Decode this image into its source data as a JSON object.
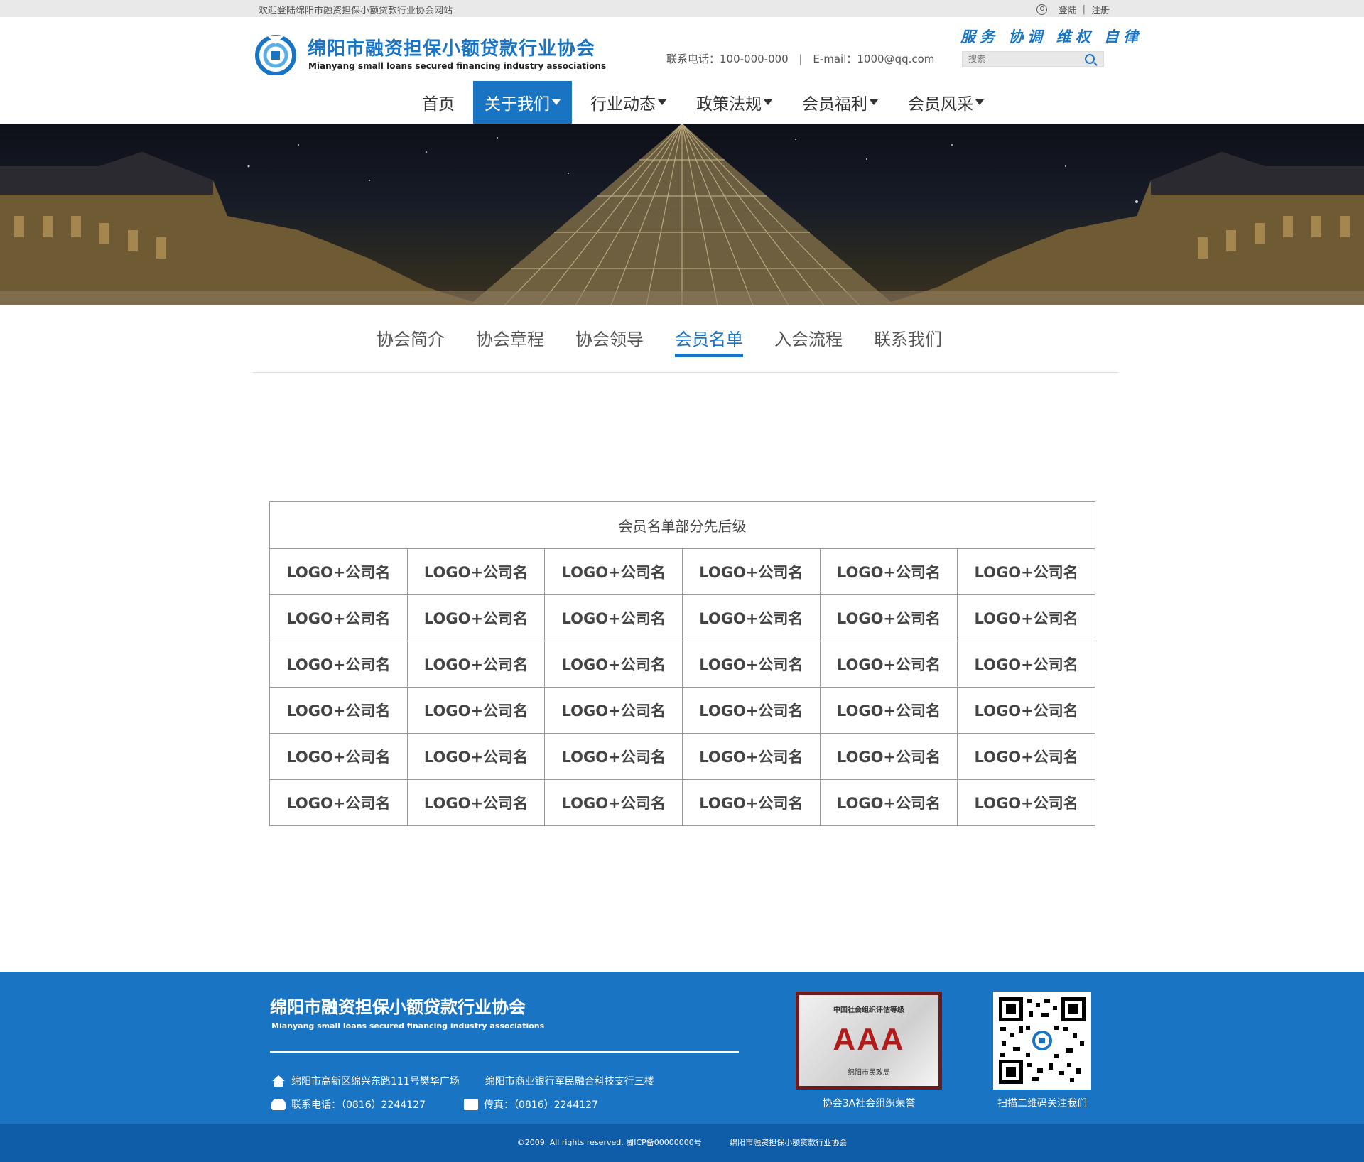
{
  "topbar": {
    "welcome": "欢迎登陆绵阳市融资担保小额贷款行业协会网站",
    "login": "登陆",
    "separator": "|",
    "register": "注册"
  },
  "header": {
    "title": "绵阳市融资担保小额贷款行业协会",
    "subtitle": "Mianyang small loans secured financing industry associations",
    "slogan": "服务 协调 维权 自律",
    "phone": "联系电话：100-000-000",
    "contact_sep": "|",
    "email": "E-mail：1000@qq.com",
    "search_placeholder": "搜索"
  },
  "nav": {
    "items": [
      {
        "label": "首页",
        "has_caret": false,
        "active": false
      },
      {
        "label": "关于我们",
        "has_caret": true,
        "active": true
      },
      {
        "label": "行业动态",
        "has_caret": true,
        "active": false
      },
      {
        "label": "政策法规",
        "has_caret": true,
        "active": false
      },
      {
        "label": "会员福利",
        "has_caret": true,
        "active": false
      },
      {
        "label": "会员风采",
        "has_caret": true,
        "active": false
      }
    ]
  },
  "subnav": {
    "items": [
      {
        "label": "协会简介",
        "active": false
      },
      {
        "label": "协会章程",
        "active": false
      },
      {
        "label": "协会领导",
        "active": false
      },
      {
        "label": "会员名单",
        "active": true
      },
      {
        "label": "入会流程",
        "active": false
      },
      {
        "label": "联系我们",
        "active": false
      }
    ]
  },
  "members": {
    "caption": "会员名单部分先后级",
    "rows": [
      [
        "LOGO+公司名",
        "LOGO+公司名",
        "LOGO+公司名",
        "LOGO+公司名",
        "LOGO+公司名",
        "LOGO+公司名"
      ],
      [
        "LOGO+公司名",
        "LOGO+公司名",
        "LOGO+公司名",
        "LOGO+公司名",
        "LOGO+公司名",
        "LOGO+公司名"
      ],
      [
        "LOGO+公司名",
        "LOGO+公司名",
        "LOGO+公司名",
        "LOGO+公司名",
        "LOGO+公司名",
        "LOGO+公司名"
      ],
      [
        "LOGO+公司名",
        "LOGO+公司名",
        "LOGO+公司名",
        "LOGO+公司名",
        "LOGO+公司名",
        "LOGO+公司名"
      ],
      [
        "LOGO+公司名",
        "LOGO+公司名",
        "LOGO+公司名",
        "LOGO+公司名",
        "LOGO+公司名",
        "LOGO+公司名"
      ],
      [
        "LOGO+公司名",
        "LOGO+公司名",
        "LOGO+公司名",
        "LOGO+公司名",
        "LOGO+公司名",
        "LOGO+公司名"
      ]
    ]
  },
  "footer": {
    "title": "绵阳市融资担保小额贷款行业协会",
    "subtitle": "Mianyang small loans secured financing industry associations",
    "address1": "绵阳市高新区绵兴东路111号樊华广场",
    "address2": "绵阳市商业银行军民融合科技支行三楼",
    "phone": "联系电话：（0816）2244127",
    "fax": "传真：（0816）2244127",
    "badge_top": "中国社会组织评估等级",
    "badge_grade": "AAA",
    "badge_bottom": "绵阳市民政局",
    "badge_caption": "协会3A社会组织荣誉",
    "qr_caption": "扫描二维码关注我们"
  },
  "copyright": {
    "text": "©2009. All rights reserved. 蜀ICP备00000000号",
    "org": "绵阳市融资担保小额贷款行业协会"
  },
  "colors": {
    "accent": "#1a74c4",
    "footer_bg": "#1a74c4",
    "copyright_bg": "#0f5da8",
    "topbar_bg": "#e9e9e9"
  }
}
